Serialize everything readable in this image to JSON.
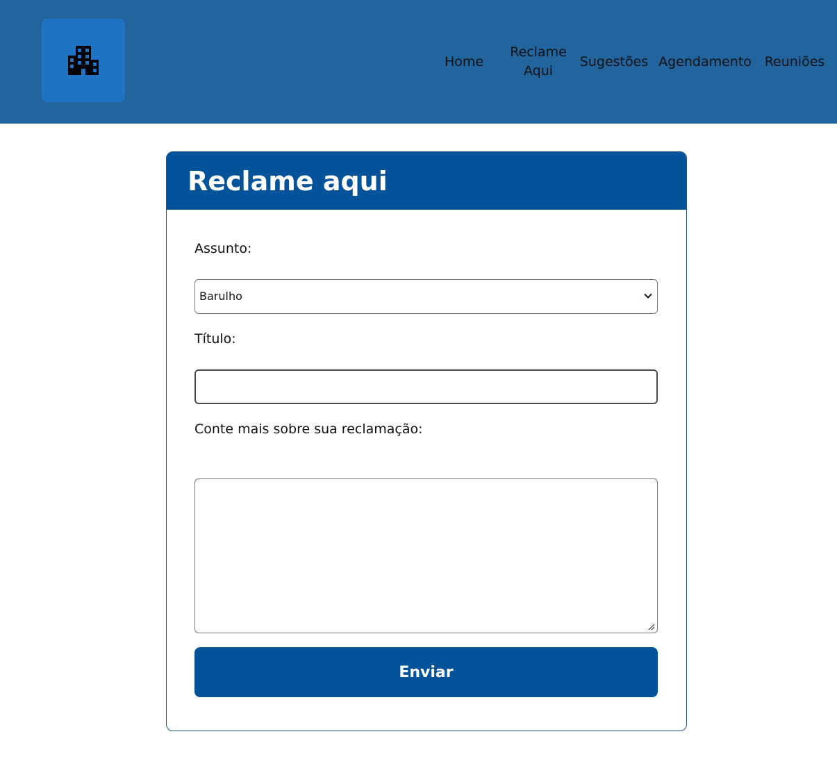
{
  "colors": {
    "topbar": "#21649e",
    "logo_bg": "#1f73c5",
    "primary": "#02539a",
    "card_border": "#1d4e86"
  },
  "header": {
    "logo_icon": "building-icon",
    "nav": [
      {
        "label": "Home"
      },
      {
        "label": "Reclame Aqui"
      },
      {
        "label": "Sugestões"
      },
      {
        "label": "Agendamento"
      },
      {
        "label": "Reuniões"
      }
    ]
  },
  "form": {
    "title": "Reclame aqui",
    "assunto_label": "Assunto:",
    "assunto_value": "Barulho",
    "titulo_label": "Título:",
    "titulo_value": "",
    "descricao_label": "Conte mais sobre sua reclamação:",
    "descricao_value": "",
    "submit_label": "Enviar"
  }
}
